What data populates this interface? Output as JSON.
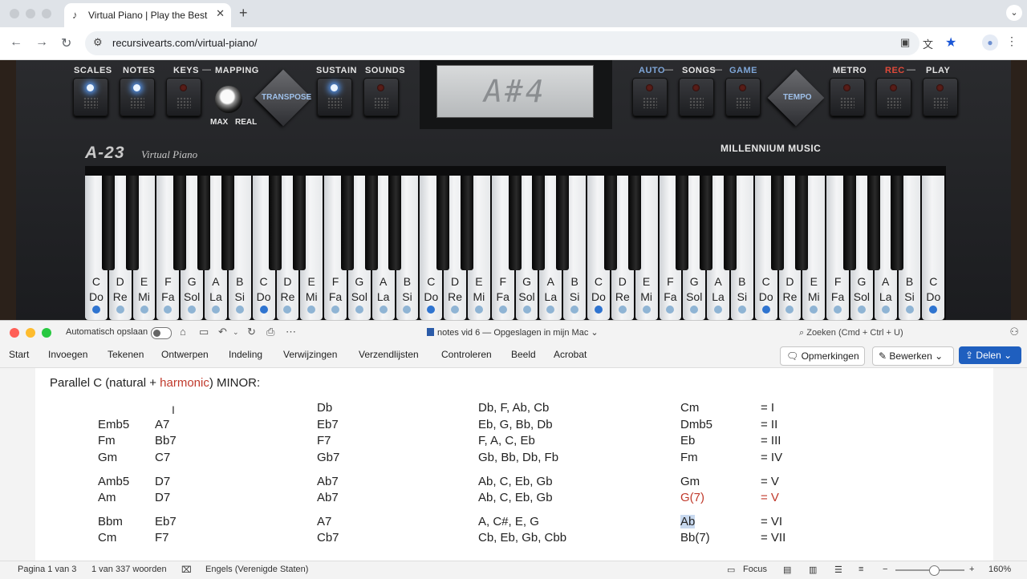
{
  "browser": {
    "tab_title": "Virtual Piano | Play the Best M",
    "url": "recursivearts.com/virtual-piano/",
    "icons": [
      "new-tab-icon",
      "back-icon",
      "forward-icon",
      "reload-icon",
      "site-settings-icon",
      "translate-icon",
      "bookmark-star-icon",
      "profile-icon",
      "menu-icon"
    ]
  },
  "piano": {
    "labels": {
      "scales": "SCALES",
      "notes": "NOTES",
      "keys": "KEYS",
      "mapping": "MAPPING",
      "max": "MAX",
      "real": "REAL",
      "transpose": "TRANSPOSE",
      "sustain": "SUSTAIN",
      "sounds": "SOUNDS",
      "auto": "AUTO",
      "songs": "SONGS",
      "game": "GAME",
      "tempo": "TEMPO",
      "metro": "METRO",
      "rec": "REC",
      "play": "PLAY",
      "dash": "—"
    },
    "display": "A#4",
    "brand": "A-23",
    "brand_sub": "Virtual Piano",
    "maker": "MILLENNIUM MUSIC",
    "keys": [
      {
        "note": "C",
        "solfege": "Do"
      },
      {
        "note": "D",
        "solfege": "Re"
      },
      {
        "note": "E",
        "solfege": "Mi"
      },
      {
        "note": "F",
        "solfege": "Fa"
      },
      {
        "note": "G",
        "solfege": "Sol"
      },
      {
        "note": "A",
        "solfege": "La"
      },
      {
        "note": "B",
        "solfege": "Si"
      },
      {
        "note": "C",
        "solfege": "Do"
      },
      {
        "note": "D",
        "solfege": "Re"
      },
      {
        "note": "E",
        "solfege": "Mi"
      },
      {
        "note": "F",
        "solfege": "Fa"
      },
      {
        "note": "G",
        "solfege": "Sol"
      },
      {
        "note": "A",
        "solfege": "La"
      },
      {
        "note": "B",
        "solfege": "Si"
      },
      {
        "note": "C",
        "solfege": "Do"
      },
      {
        "note": "D",
        "solfege": "Re"
      },
      {
        "note": "E",
        "solfege": "Mi"
      },
      {
        "note": "F",
        "solfege": "Fa"
      },
      {
        "note": "G",
        "solfege": "Sol"
      },
      {
        "note": "A",
        "solfege": "La"
      },
      {
        "note": "B",
        "solfege": "Si"
      },
      {
        "note": "C",
        "solfege": "Do"
      },
      {
        "note": "D",
        "solfege": "Re"
      },
      {
        "note": "E",
        "solfege": "Mi"
      },
      {
        "note": "F",
        "solfege": "Fa"
      },
      {
        "note": "G",
        "solfege": "Sol"
      },
      {
        "note": "A",
        "solfege": "La"
      },
      {
        "note": "B",
        "solfege": "Si"
      },
      {
        "note": "C",
        "solfege": "Do"
      },
      {
        "note": "D",
        "solfege": "Re"
      },
      {
        "note": "E",
        "solfege": "Mi"
      },
      {
        "note": "F",
        "solfege": "Fa"
      },
      {
        "note": "G",
        "solfege": "Sol"
      },
      {
        "note": "A",
        "solfege": "La"
      },
      {
        "note": "B",
        "solfege": "Si"
      },
      {
        "note": "C",
        "solfege": "Do"
      }
    ]
  },
  "word": {
    "autosave_label": "Automatisch opslaan",
    "doc_title": "notes vid 6 — Opgeslagen in mijn Mac",
    "search_placeholder": "Zoeken (Cmd + Ctrl + U)",
    "ribbon_tabs": [
      "Start",
      "Invoegen",
      "Tekenen",
      "Ontwerpen",
      "Indeling",
      "Verwijzingen",
      "Verzendlijsten",
      "Controleren",
      "Beeld",
      "Acrobat"
    ],
    "comments_btn": "Opmerkingen",
    "edit_btn": "Bewerken",
    "share_btn": "Delen",
    "heading": {
      "pre": "Parallel C (natural + ",
      "red": "harmonic",
      "post": ") MINOR:"
    },
    "table": {
      "col1": [
        "",
        "Emb5",
        "Fm",
        "Gm",
        "Amb5",
        "Am",
        "Bbm",
        "Cm"
      ],
      "col2": [
        "",
        "A7",
        "Bb7",
        "C7",
        "D7",
        "D7",
        "Eb7",
        "F7"
      ],
      "col3": [
        "Db",
        "Eb7",
        "F7",
        "Gb7",
        "Ab7",
        "Ab7",
        "A7",
        "Cb7"
      ],
      "col4": [
        "Db, F, Ab, Cb",
        "Eb, G, Bb, Db",
        "F, A, C, Eb",
        "Gb, Bb, Db, Fb",
        "Ab, C, Eb, Gb",
        "Ab, C, Eb, Gb",
        "A, C#, E, G",
        "Cb, Eb, Gb, Cbb"
      ],
      "col5": [
        "Cm",
        "Dmb5",
        "Eb",
        "Fm",
        "Gm",
        "G(7)",
        "Ab",
        "Bb(7)"
      ],
      "col6": [
        "= I",
        "= II",
        "= III",
        "= IV",
        "= V",
        "= V",
        "= VI",
        "= VII"
      ]
    },
    "status": {
      "page": "Pagina 1 van 3",
      "words": "1 van 337 woorden",
      "language": "Engels (Verenigde Staten)",
      "focus": "Focus",
      "zoom": "160%",
      "zoom_level_fraction": 0.5
    }
  }
}
